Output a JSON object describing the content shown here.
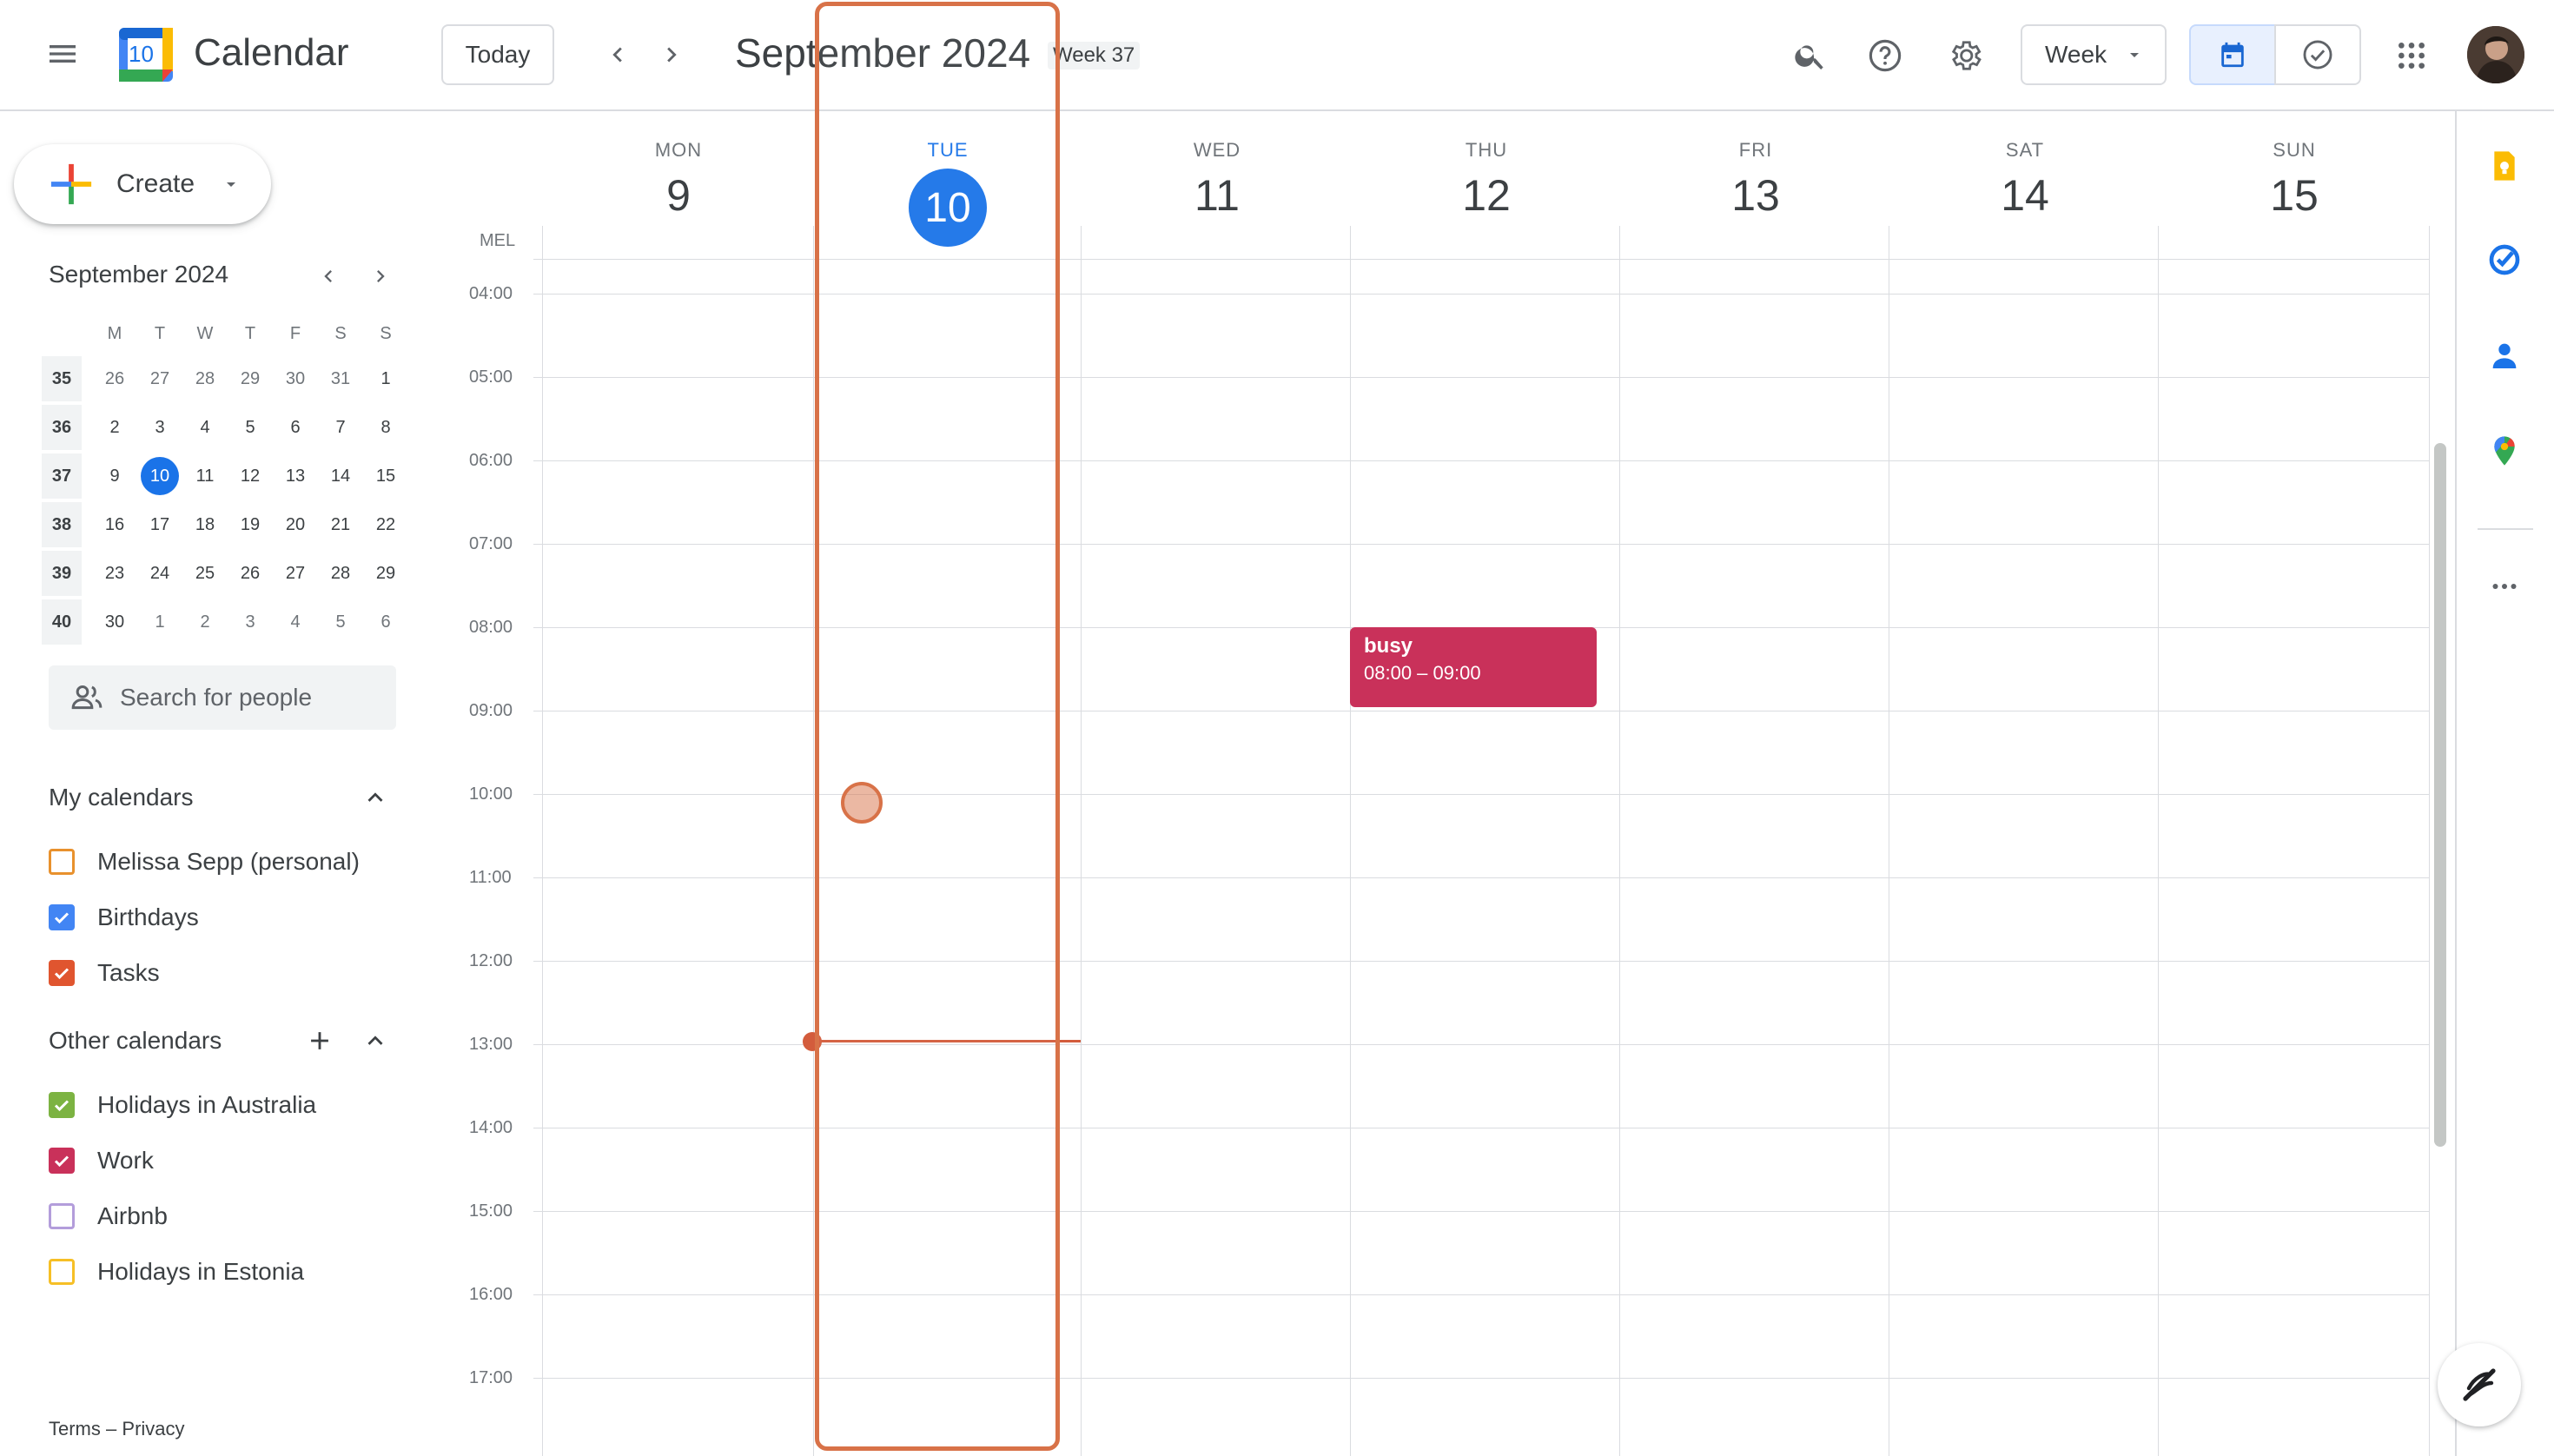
{
  "header": {
    "app_title": "Calendar",
    "logo_day": "10",
    "today_label": "Today",
    "month_title": "September 2024",
    "week_badge": "Week 37",
    "view_label": "Week"
  },
  "sidebar": {
    "create_label": "Create",
    "mini_calendar": {
      "title": "September 2024",
      "weekday_heads": [
        "M",
        "T",
        "W",
        "T",
        "F",
        "S",
        "S"
      ],
      "weeks": [
        {
          "wk": "35",
          "days": [
            "26",
            "27",
            "28",
            "29",
            "30",
            "31",
            "1"
          ]
        },
        {
          "wk": "36",
          "days": [
            "2",
            "3",
            "4",
            "5",
            "6",
            "7",
            "8"
          ]
        },
        {
          "wk": "37",
          "days": [
            "9",
            "10",
            "11",
            "12",
            "13",
            "14",
            "15"
          ]
        },
        {
          "wk": "38",
          "days": [
            "16",
            "17",
            "18",
            "19",
            "20",
            "21",
            "22"
          ]
        },
        {
          "wk": "39",
          "days": [
            "23",
            "24",
            "25",
            "26",
            "27",
            "28",
            "29"
          ]
        },
        {
          "wk": "40",
          "days": [
            "30",
            "1",
            "2",
            "3",
            "4",
            "5",
            "6"
          ]
        }
      ]
    },
    "search_people_placeholder": "Search for people",
    "my_calendars_title": "My calendars",
    "my_calendars": [
      {
        "label": "Melissa Sepp (personal)",
        "color": "#e8912d",
        "checked": false
      },
      {
        "label": "Birthdays",
        "color": "#4285f4",
        "checked": true
      },
      {
        "label": "Tasks",
        "color": "#e0552f",
        "checked": true
      }
    ],
    "other_calendars_title": "Other calendars",
    "other_calendars": [
      {
        "label": "Holidays in Australia",
        "color": "#7cb342",
        "checked": true
      },
      {
        "label": "Work",
        "color": "#c9315a",
        "checked": true
      },
      {
        "label": "Airbnb",
        "color": "#b39ddb",
        "checked": false
      },
      {
        "label": "Holidays in Estonia",
        "color": "#f6bf26",
        "checked": false
      }
    ],
    "footer_terms": "Terms",
    "footer_sep": "–",
    "footer_privacy": "Privacy"
  },
  "grid": {
    "timezone": "MEL",
    "days": [
      {
        "dow": "MON",
        "num": "9"
      },
      {
        "dow": "TUE",
        "num": "10",
        "today": true
      },
      {
        "dow": "WED",
        "num": "11"
      },
      {
        "dow": "THU",
        "num": "12"
      },
      {
        "dow": "FRI",
        "num": "13"
      },
      {
        "dow": "SAT",
        "num": "14"
      },
      {
        "dow": "SUN",
        "num": "15"
      }
    ],
    "hours": [
      "04:00",
      "05:00",
      "06:00",
      "07:00",
      "08:00",
      "09:00",
      "10:00",
      "11:00",
      "12:00",
      "13:00",
      "14:00",
      "15:00",
      "16:00",
      "17:00"
    ],
    "event": {
      "title": "busy",
      "time": "08:00 – 09:00",
      "color": "#c9315a"
    }
  },
  "colors": {
    "accent": "#1a73e8",
    "now_line": "#d35c3c",
    "highlight": "#d87248"
  }
}
